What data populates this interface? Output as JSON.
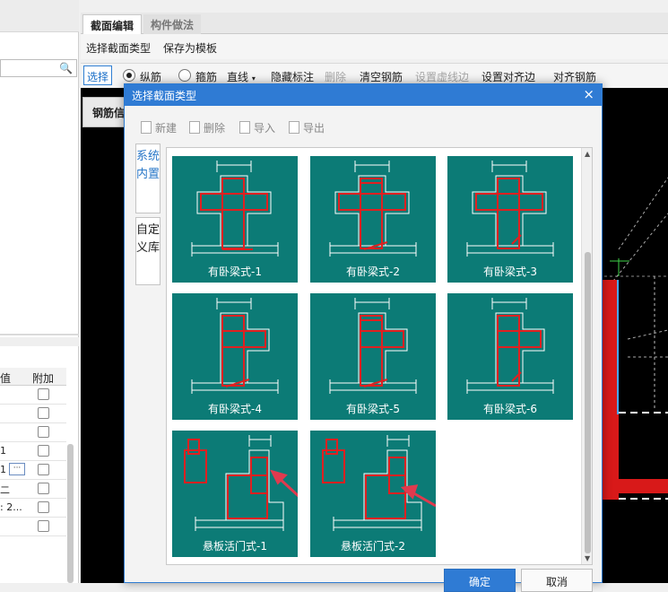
{
  "colors": {
    "accent": "#2f7bd4",
    "thumb_bg": "#0c7b76",
    "rebar": "#d81919",
    "canvas": "#000000",
    "arrow": "#e03a4e"
  },
  "left_panel": {
    "search_icon": "search-icon",
    "attr_header": {
      "col1": "值",
      "col2": "附加"
    },
    "rows": [
      {
        "value": ""
      },
      {
        "value": ""
      },
      {
        "value": ""
      },
      {
        "value": "1"
      },
      {
        "value": "1"
      },
      {
        "value": "二"
      },
      {
        "value": ": 2..."
      },
      {
        "value": ""
      }
    ]
  },
  "editor": {
    "tabs": [
      "截面编辑",
      "构件做法"
    ],
    "toolbar1": [
      "选择截面类型",
      "保存为模板"
    ],
    "toolbar2": {
      "select": "选择",
      "radio_longitudinal": "纵筋",
      "radio_stirrup": "箍筋",
      "line": "直线",
      "hide_dims": "隐藏标注",
      "delete": "删除",
      "clear_rebar": "清空钢筋",
      "set_virtual_edge": "设置虚线边",
      "set_align_edge": "设置对齐边",
      "align_rebar": "对齐钢筋"
    },
    "rebar_info": "钢筋信"
  },
  "dialog": {
    "title": "选择截面类型",
    "close": "×",
    "tools": {
      "new": "新建",
      "delete": "删除",
      "import": "导入",
      "export": "导出"
    },
    "side_tabs": {
      "builtin": "系统内置",
      "custom": "自定义库"
    },
    "items": [
      {
        "label": "有卧梁式-1"
      },
      {
        "label": "有卧梁式-2"
      },
      {
        "label": "有卧梁式-3"
      },
      {
        "label": "有卧梁式-4"
      },
      {
        "label": "有卧梁式-5"
      },
      {
        "label": "有卧梁式-6"
      },
      {
        "label": "悬板活门式-1"
      },
      {
        "label": "悬板活门式-2"
      }
    ],
    "ok": "确定",
    "cancel": "取消"
  }
}
